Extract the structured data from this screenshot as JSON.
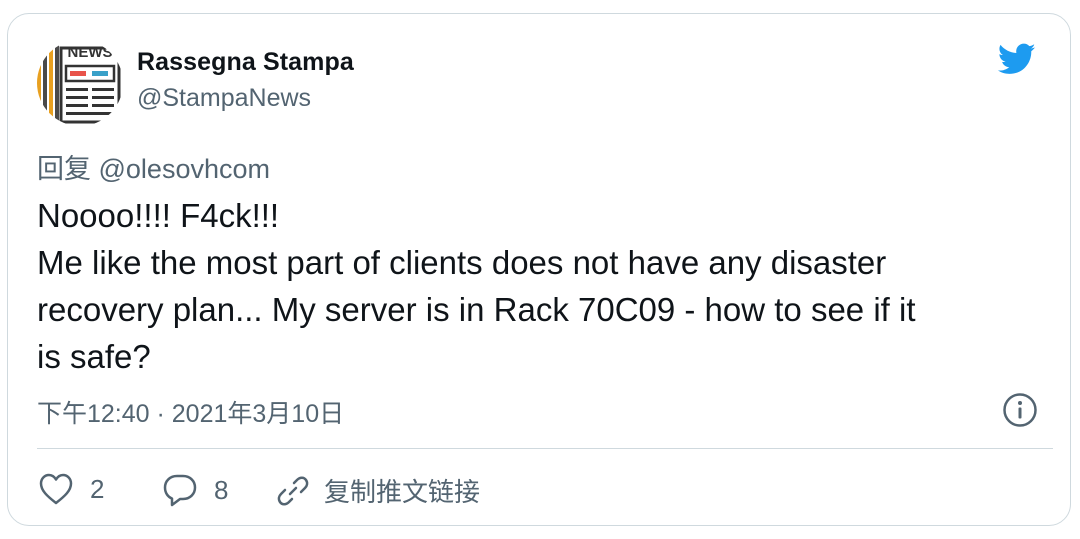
{
  "author": {
    "name": "Rassegna Stampa",
    "handle": "@StampaNews",
    "avatar_icon": "news-icon",
    "avatar_text": "NEWS"
  },
  "reply_to": "回复 @olesovhcom",
  "tweet": {
    "lines": [
      "Noooo!!!! F4ck!!!",
      "Me like the most part of clients does not have any disaster",
      "recovery plan... My server is in Rack 70C09 - how to see if it",
      "is safe?"
    ]
  },
  "timestamp": "下午12:40 · 2021年3月10日",
  "actions": {
    "like_count": "2",
    "reply_count": "8",
    "copy_link_label": "复制推文链接"
  },
  "colors": {
    "twitter_blue": "#1d9bf0",
    "text_primary": "#0f1419",
    "text_secondary": "#536471",
    "border": "#cfd9de"
  }
}
